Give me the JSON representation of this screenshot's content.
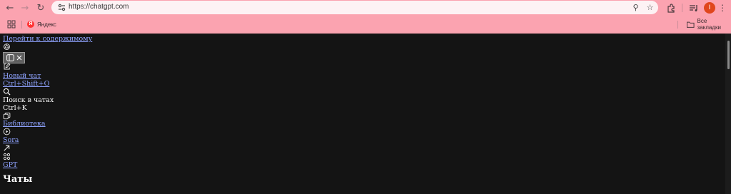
{
  "browser": {
    "url": "https://chatgpt.com",
    "profile_initial": "I",
    "bookmarks": [
      {
        "label": "Яндекс"
      }
    ],
    "all_bookmarks_label": "Все закладки"
  },
  "sidebar": {
    "skip_link": "Перейти к содержимому",
    "new_chat_label": "Новый чат",
    "new_chat_shortcut": "Ctrl+Shift+O",
    "search_label": "Поиск в чатах",
    "search_shortcut": "Ctrl+K",
    "library_label": "Библиотека",
    "sora_label": "Sora",
    "gpt_label": "GPT",
    "chats_heading": "Чаты"
  }
}
